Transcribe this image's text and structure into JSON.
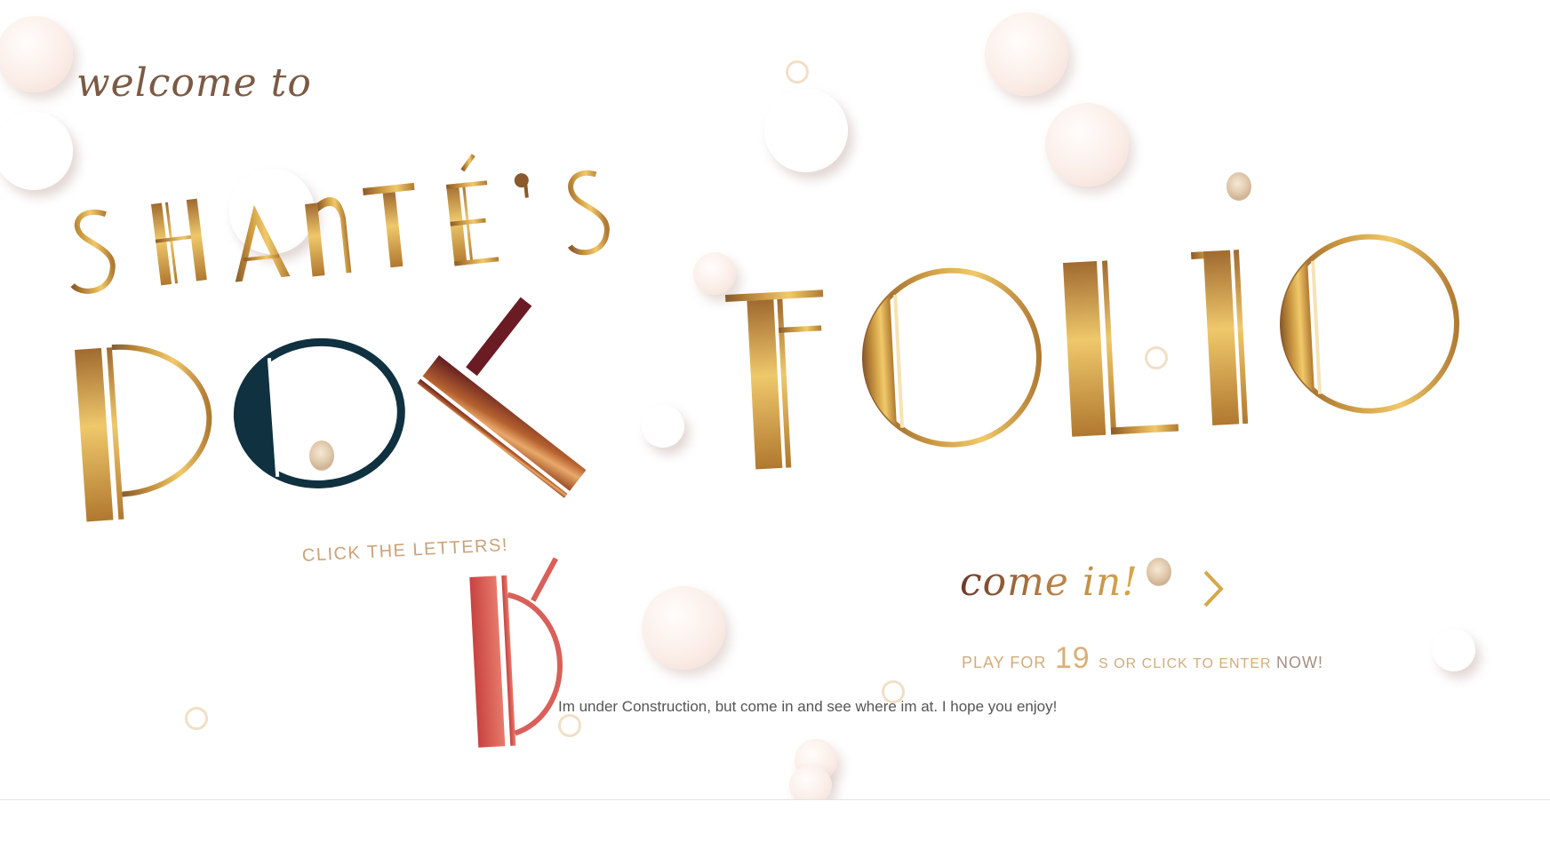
{
  "welcome_text": "welcome to",
  "owner_text": "SHANTÉ'S",
  "port_text": "PORT",
  "folio_text": "FOLIO",
  "click_hint": "CLICK THE LETTERS!",
  "come_in_text": "come in!",
  "play_prefix": "PLAY FOR",
  "countdown": "19",
  "play_suffix": "S OR CLICK TO ENTER",
  "play_now": "NOW!",
  "construction_note": "Im under Construction, but come in and see where im at. I hope you enjoy!",
  "icons": {
    "enter": "chevron-right-icon"
  },
  "colors": {
    "gold": "#d4a94b",
    "gold_dark": "#8a5a2b",
    "navy": "#0f3140",
    "wine": "#6b1b24",
    "coral": "#d9605a",
    "blush": "#f6e3dc"
  }
}
